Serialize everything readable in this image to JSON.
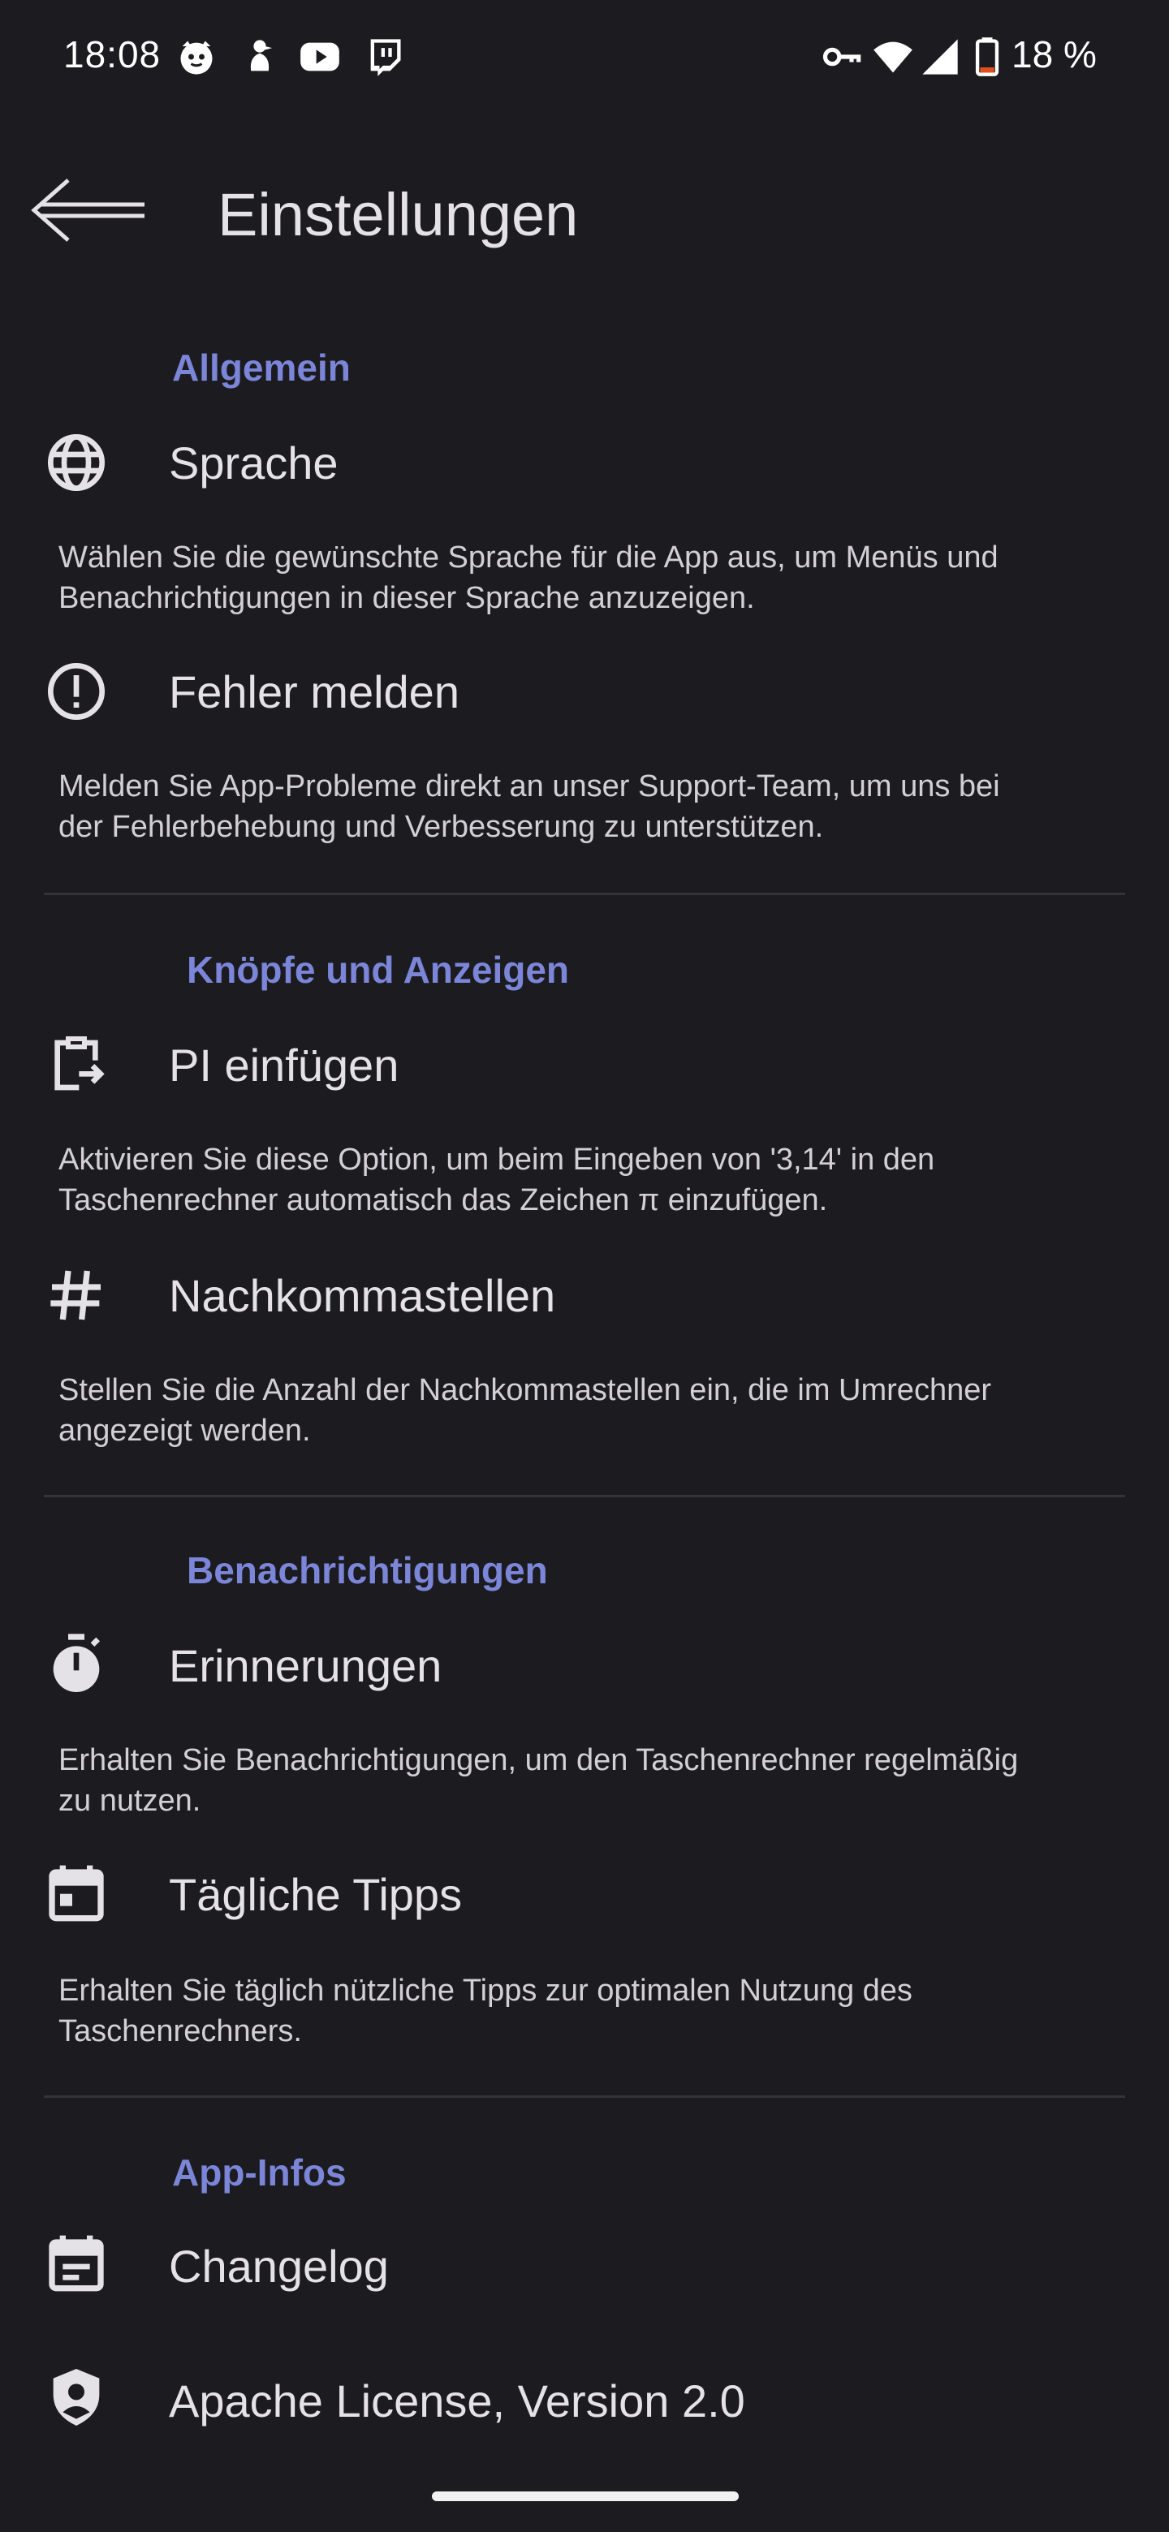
{
  "status_bar": {
    "time": "18:08",
    "battery": "18 %",
    "left_icons": [
      "cat-face-icon",
      "bird-icon",
      "youtube-icon",
      "twitch-icon"
    ],
    "right_icons": [
      "vpn-key-icon",
      "wifi-icon",
      "cell-signal-icon",
      "battery-icon"
    ]
  },
  "toolbar": {
    "title": "Einstellungen",
    "back_icon": "back-arrow-icon"
  },
  "sections": [
    {
      "header": "Allgemein",
      "items": [
        {
          "icon": "globe-icon",
          "title": "Sprache",
          "desc_1": "Wählen Sie die gewünschte Sprache für die App aus, um Menüs und",
          "desc_2": "Benachrichtigungen in dieser Sprache anzuzeigen."
        },
        {
          "icon": "alert-circle-icon",
          "title": "Fehler melden",
          "desc_1": "Melden Sie App-Probleme direkt an unser Support-Team, um uns bei",
          "desc_2": "der Fehlerbehebung und Verbesserung zu unterstützen."
        }
      ]
    },
    {
      "header": "Knöpfe und Anzeigen",
      "items": [
        {
          "icon": "clipboard-paste-icon",
          "title": "PI einfügen",
          "desc_1": "Aktivieren Sie diese Option, um beim Eingeben von '3,14' in den",
          "desc_2": "Taschenrechner automatisch das Zeichen π einzufügen."
        },
        {
          "icon": "hash-icon",
          "title": "Nachkommastellen",
          "desc_1": "Stellen Sie die Anzahl der Nachkommastellen ein, die im Umrechner",
          "desc_2": "angezeigt werden."
        }
      ]
    },
    {
      "header": "Benachrichtigungen",
      "items": [
        {
          "icon": "stopwatch-icon",
          "title": "Erinnerungen",
          "desc_1": "Erhalten Sie Benachrichtigungen, um den Taschenrechner regelmäßig",
          "desc_2": "zu nutzen."
        },
        {
          "icon": "calendar-icon",
          "title": "Tägliche Tipps",
          "desc_1": "Erhalten Sie täglich nützliche Tipps zur optimalen Nutzung des",
          "desc_2": "Taschenrechners."
        }
      ]
    },
    {
      "header": "App-Infos",
      "items": [
        {
          "icon": "event-note-icon",
          "title": "Changelog"
        },
        {
          "icon": "shield-person-icon",
          "title": "Apache License, Version 2.0"
        }
      ]
    }
  ],
  "colors": {
    "background": "#1c1b20",
    "accent": "#7b86d8",
    "text_primary": "#e4e2e6",
    "text_secondary": "#d2d0d6",
    "divider": "#34333a"
  }
}
